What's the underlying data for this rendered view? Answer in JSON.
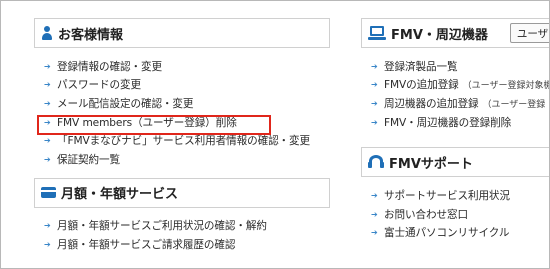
{
  "accent_color": "#1f6fb7",
  "arrow_color": "#3a86c8",
  "highlight_color": "#e0261b",
  "left": {
    "customer_section": {
      "icon": "person-icon",
      "title": "お客様情報",
      "items": [
        "登録情報の確認・変更",
        "パスワードの変更",
        "メール配信設定の確認・変更",
        "FMV members（ユーザー登録）削除",
        "「FMVまなびナビ」サービス利用者情報の確認・変更",
        "保証契約一覧"
      ]
    },
    "subscription_section": {
      "icon": "credit-card-icon",
      "title": "月額・年額サービス",
      "items": [
        "月額・年額サービスご利用状況の確認・解約",
        "月額・年額サービスご請求履歴の確認"
      ]
    }
  },
  "right": {
    "fmv_section": {
      "icon": "computer-icon",
      "title": "FMV・周辺機器",
      "tab_label": "ユーザ",
      "items": [
        "登録済製品一覧",
        "FMVの追加登録",
        "周辺機器の追加登録",
        "FMV・周辺機器の登録削除"
      ],
      "notes": {
        "fmv_add": "（ユーザー登録対象機",
        "peripheral_add": "（ユーザー登録"
      }
    },
    "support_section": {
      "icon": "headset-icon",
      "title": "FMVサポート",
      "items": [
        "サポートサービス利用状況",
        "お問い合わせ窓口",
        "富士通パソコンリサイクル"
      ]
    }
  }
}
